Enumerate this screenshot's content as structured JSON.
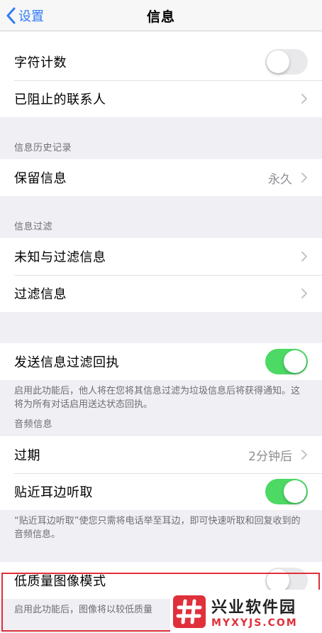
{
  "nav": {
    "back_label": "设置",
    "title": "信息"
  },
  "top_group": {
    "char_count": {
      "label": "字符计数",
      "toggle": "off"
    },
    "blocked": {
      "label": "已阻止的联系人"
    }
  },
  "history": {
    "header": "信息历史记录",
    "keep": {
      "label": "保留信息",
      "value": "永久"
    }
  },
  "filtering": {
    "header": "信息过滤",
    "unknown": {
      "label": "未知与过滤信息"
    },
    "filtered": {
      "label": "过滤信息"
    }
  },
  "receipt": {
    "label": "发送信息过滤回执",
    "toggle": "on",
    "footer": "启用此功能后，他人将在您将其信息过滤为垃圾信息后将获得通知。这将为所有对话启用送达状态回执。"
  },
  "audio": {
    "header": "音频信息",
    "expire": {
      "label": "过期",
      "value": "2分钟后"
    },
    "raise": {
      "label": "贴近耳边听取",
      "toggle": "on"
    },
    "footer": "“贴近耳边听取”使您只需将电话举至耳边，即可快速听取和回复收到的音频信息。"
  },
  "low_quality": {
    "label": "低质量图像模式",
    "footer": "启用此功能后，图像将以较低质量"
  },
  "watermark": {
    "title": "兴业软件园",
    "subtitle": "MYXYJS.COM"
  },
  "colors": {
    "accent": "#2f7cf6",
    "toggle_on": "#4cd964",
    "highlight": "#e0303a"
  }
}
